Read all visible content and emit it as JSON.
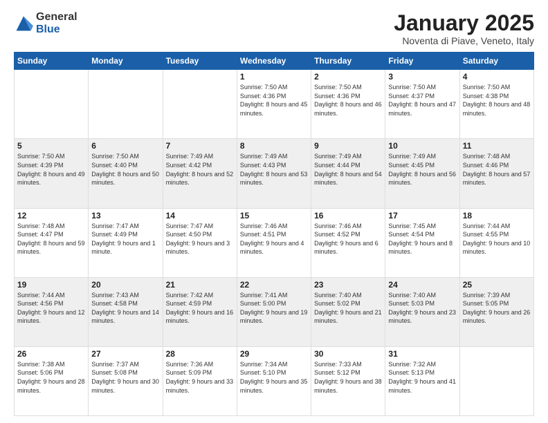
{
  "logo": {
    "general": "General",
    "blue": "Blue"
  },
  "title": "January 2025",
  "subtitle": "Noventa di Piave, Veneto, Italy",
  "days_of_week": [
    "Sunday",
    "Monday",
    "Tuesday",
    "Wednesday",
    "Thursday",
    "Friday",
    "Saturday"
  ],
  "weeks": [
    [
      {
        "day": "",
        "sunrise": "",
        "sunset": "",
        "daylight": ""
      },
      {
        "day": "",
        "sunrise": "",
        "sunset": "",
        "daylight": ""
      },
      {
        "day": "",
        "sunrise": "",
        "sunset": "",
        "daylight": ""
      },
      {
        "day": "1",
        "sunrise": "Sunrise: 7:50 AM",
        "sunset": "Sunset: 4:36 PM",
        "daylight": "Daylight: 8 hours and 45 minutes."
      },
      {
        "day": "2",
        "sunrise": "Sunrise: 7:50 AM",
        "sunset": "Sunset: 4:36 PM",
        "daylight": "Daylight: 8 hours and 46 minutes."
      },
      {
        "day": "3",
        "sunrise": "Sunrise: 7:50 AM",
        "sunset": "Sunset: 4:37 PM",
        "daylight": "Daylight: 8 hours and 47 minutes."
      },
      {
        "day": "4",
        "sunrise": "Sunrise: 7:50 AM",
        "sunset": "Sunset: 4:38 PM",
        "daylight": "Daylight: 8 hours and 48 minutes."
      }
    ],
    [
      {
        "day": "5",
        "sunrise": "Sunrise: 7:50 AM",
        "sunset": "Sunset: 4:39 PM",
        "daylight": "Daylight: 8 hours and 49 minutes."
      },
      {
        "day": "6",
        "sunrise": "Sunrise: 7:50 AM",
        "sunset": "Sunset: 4:40 PM",
        "daylight": "Daylight: 8 hours and 50 minutes."
      },
      {
        "day": "7",
        "sunrise": "Sunrise: 7:49 AM",
        "sunset": "Sunset: 4:42 PM",
        "daylight": "Daylight: 8 hours and 52 minutes."
      },
      {
        "day": "8",
        "sunrise": "Sunrise: 7:49 AM",
        "sunset": "Sunset: 4:43 PM",
        "daylight": "Daylight: 8 hours and 53 minutes."
      },
      {
        "day": "9",
        "sunrise": "Sunrise: 7:49 AM",
        "sunset": "Sunset: 4:44 PM",
        "daylight": "Daylight: 8 hours and 54 minutes."
      },
      {
        "day": "10",
        "sunrise": "Sunrise: 7:49 AM",
        "sunset": "Sunset: 4:45 PM",
        "daylight": "Daylight: 8 hours and 56 minutes."
      },
      {
        "day": "11",
        "sunrise": "Sunrise: 7:48 AM",
        "sunset": "Sunset: 4:46 PM",
        "daylight": "Daylight: 8 hours and 57 minutes."
      }
    ],
    [
      {
        "day": "12",
        "sunrise": "Sunrise: 7:48 AM",
        "sunset": "Sunset: 4:47 PM",
        "daylight": "Daylight: 8 hours and 59 minutes."
      },
      {
        "day": "13",
        "sunrise": "Sunrise: 7:47 AM",
        "sunset": "Sunset: 4:49 PM",
        "daylight": "Daylight: 9 hours and 1 minute."
      },
      {
        "day": "14",
        "sunrise": "Sunrise: 7:47 AM",
        "sunset": "Sunset: 4:50 PM",
        "daylight": "Daylight: 9 hours and 3 minutes."
      },
      {
        "day": "15",
        "sunrise": "Sunrise: 7:46 AM",
        "sunset": "Sunset: 4:51 PM",
        "daylight": "Daylight: 9 hours and 4 minutes."
      },
      {
        "day": "16",
        "sunrise": "Sunrise: 7:46 AM",
        "sunset": "Sunset: 4:52 PM",
        "daylight": "Daylight: 9 hours and 6 minutes."
      },
      {
        "day": "17",
        "sunrise": "Sunrise: 7:45 AM",
        "sunset": "Sunset: 4:54 PM",
        "daylight": "Daylight: 9 hours and 8 minutes."
      },
      {
        "day": "18",
        "sunrise": "Sunrise: 7:44 AM",
        "sunset": "Sunset: 4:55 PM",
        "daylight": "Daylight: 9 hours and 10 minutes."
      }
    ],
    [
      {
        "day": "19",
        "sunrise": "Sunrise: 7:44 AM",
        "sunset": "Sunset: 4:56 PM",
        "daylight": "Daylight: 9 hours and 12 minutes."
      },
      {
        "day": "20",
        "sunrise": "Sunrise: 7:43 AM",
        "sunset": "Sunset: 4:58 PM",
        "daylight": "Daylight: 9 hours and 14 minutes."
      },
      {
        "day": "21",
        "sunrise": "Sunrise: 7:42 AM",
        "sunset": "Sunset: 4:59 PM",
        "daylight": "Daylight: 9 hours and 16 minutes."
      },
      {
        "day": "22",
        "sunrise": "Sunrise: 7:41 AM",
        "sunset": "Sunset: 5:00 PM",
        "daylight": "Daylight: 9 hours and 19 minutes."
      },
      {
        "day": "23",
        "sunrise": "Sunrise: 7:40 AM",
        "sunset": "Sunset: 5:02 PM",
        "daylight": "Daylight: 9 hours and 21 minutes."
      },
      {
        "day": "24",
        "sunrise": "Sunrise: 7:40 AM",
        "sunset": "Sunset: 5:03 PM",
        "daylight": "Daylight: 9 hours and 23 minutes."
      },
      {
        "day": "25",
        "sunrise": "Sunrise: 7:39 AM",
        "sunset": "Sunset: 5:05 PM",
        "daylight": "Daylight: 9 hours and 26 minutes."
      }
    ],
    [
      {
        "day": "26",
        "sunrise": "Sunrise: 7:38 AM",
        "sunset": "Sunset: 5:06 PM",
        "daylight": "Daylight: 9 hours and 28 minutes."
      },
      {
        "day": "27",
        "sunrise": "Sunrise: 7:37 AM",
        "sunset": "Sunset: 5:08 PM",
        "daylight": "Daylight: 9 hours and 30 minutes."
      },
      {
        "day": "28",
        "sunrise": "Sunrise: 7:36 AM",
        "sunset": "Sunset: 5:09 PM",
        "daylight": "Daylight: 9 hours and 33 minutes."
      },
      {
        "day": "29",
        "sunrise": "Sunrise: 7:34 AM",
        "sunset": "Sunset: 5:10 PM",
        "daylight": "Daylight: 9 hours and 35 minutes."
      },
      {
        "day": "30",
        "sunrise": "Sunrise: 7:33 AM",
        "sunset": "Sunset: 5:12 PM",
        "daylight": "Daylight: 9 hours and 38 minutes."
      },
      {
        "day": "31",
        "sunrise": "Sunrise: 7:32 AM",
        "sunset": "Sunset: 5:13 PM",
        "daylight": "Daylight: 9 hours and 41 minutes."
      },
      {
        "day": "",
        "sunrise": "",
        "sunset": "",
        "daylight": ""
      }
    ]
  ]
}
